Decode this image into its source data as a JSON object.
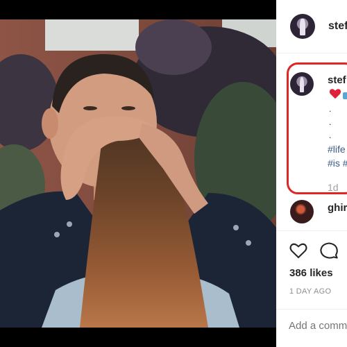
{
  "post": {
    "username": "stefa",
    "image_subject": "man-covering-face-with-womans-hair"
  },
  "caption": {
    "username": "stef",
    "dots": [
      ".",
      ".",
      "."
    ],
    "hashtags": [
      "#life",
      "#is #"
    ],
    "time": "1d",
    "highlight_color": "#e02525"
  },
  "comment": {
    "username": "ghir"
  },
  "actions": {
    "icons": [
      "heart-icon",
      "comment-icon"
    ],
    "likes": "386 likes",
    "time_ago": "1 DAY AGO",
    "add_comment_placeholder": "Add a comm"
  },
  "colors": {
    "hashtag": "#3b5a86",
    "heart": "#ed4956"
  }
}
